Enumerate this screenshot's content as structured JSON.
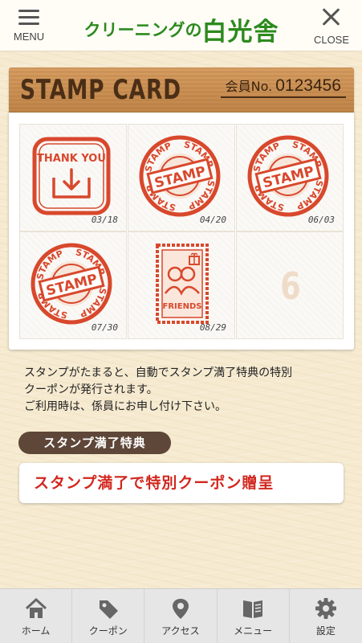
{
  "header": {
    "menu_label": "MENU",
    "close_label": "CLOSE",
    "logo_small": "クリーニングの",
    "logo_big": "白光舎"
  },
  "card": {
    "title": "STAMP CARD",
    "member_label": "会員No.",
    "member_number": "0123456",
    "cells": [
      {
        "type": "thank-you",
        "badge_text": "THANK YOU",
        "date": "03/18"
      },
      {
        "type": "stamp",
        "badge_text": "STAMP",
        "date": "04/20"
      },
      {
        "type": "stamp",
        "badge_text": "STAMP",
        "date": "06/03"
      },
      {
        "type": "stamp",
        "badge_text": "STAMP",
        "date": "07/30"
      },
      {
        "type": "friends",
        "badge_text": "FRIENDS",
        "date": "08/29"
      },
      {
        "type": "empty",
        "number": "6"
      }
    ],
    "ring_text": "STAMP"
  },
  "description": {
    "line1": "スタンプがたまると、自動でスタンプ満了特典の特別",
    "line2": "クーポンが発行されます。",
    "line3": "ご利用時は、係員にお申し付け下さい。"
  },
  "benefit": {
    "ribbon_label": "スタンプ満了特典",
    "reward_text": "スタンプ満了で特別クーポン贈呈"
  },
  "tabbar": {
    "items": [
      {
        "label": "ホーム",
        "icon": "home-icon"
      },
      {
        "label": "クーポン",
        "icon": "tag-icon"
      },
      {
        "label": "アクセス",
        "icon": "map-pin-icon"
      },
      {
        "label": "メニュー",
        "icon": "book-icon"
      },
      {
        "label": "設定",
        "icon": "gear-icon"
      }
    ]
  },
  "colors": {
    "brand_green": "#2d8a1e",
    "stamp_red": "#d8482c",
    "reward_red": "#d2271e",
    "ribbon_brown": "#5e4638"
  }
}
